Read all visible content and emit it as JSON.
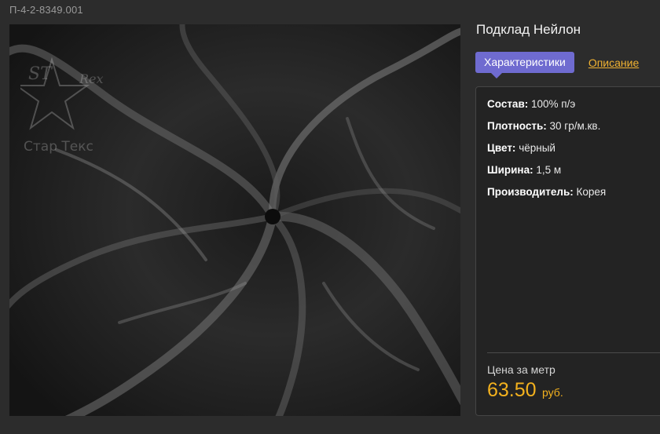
{
  "product": {
    "sku": "П-4-2-8349.001",
    "title": "Подклад Нейлон",
    "watermark_text": "Стар Текс"
  },
  "tabs": {
    "active_label": "Характеристики",
    "link_label": "Описание"
  },
  "specs": [
    {
      "key": "Состав:",
      "value": "100% п/э"
    },
    {
      "key": "Плотность:",
      "value": "30 гр/м.кв."
    },
    {
      "key": "Цвет:",
      "value": "чёрный"
    },
    {
      "key": "Ширина:",
      "value": "1,5 м"
    },
    {
      "key": "Производитель:",
      "value": "Корея"
    }
  ],
  "price": {
    "label": "Цена за метр",
    "value": "63.50",
    "currency": "руб."
  },
  "colors": {
    "accent_tab": "#6f6bd0",
    "price": "#f3b11e",
    "link": "#f0b232"
  }
}
